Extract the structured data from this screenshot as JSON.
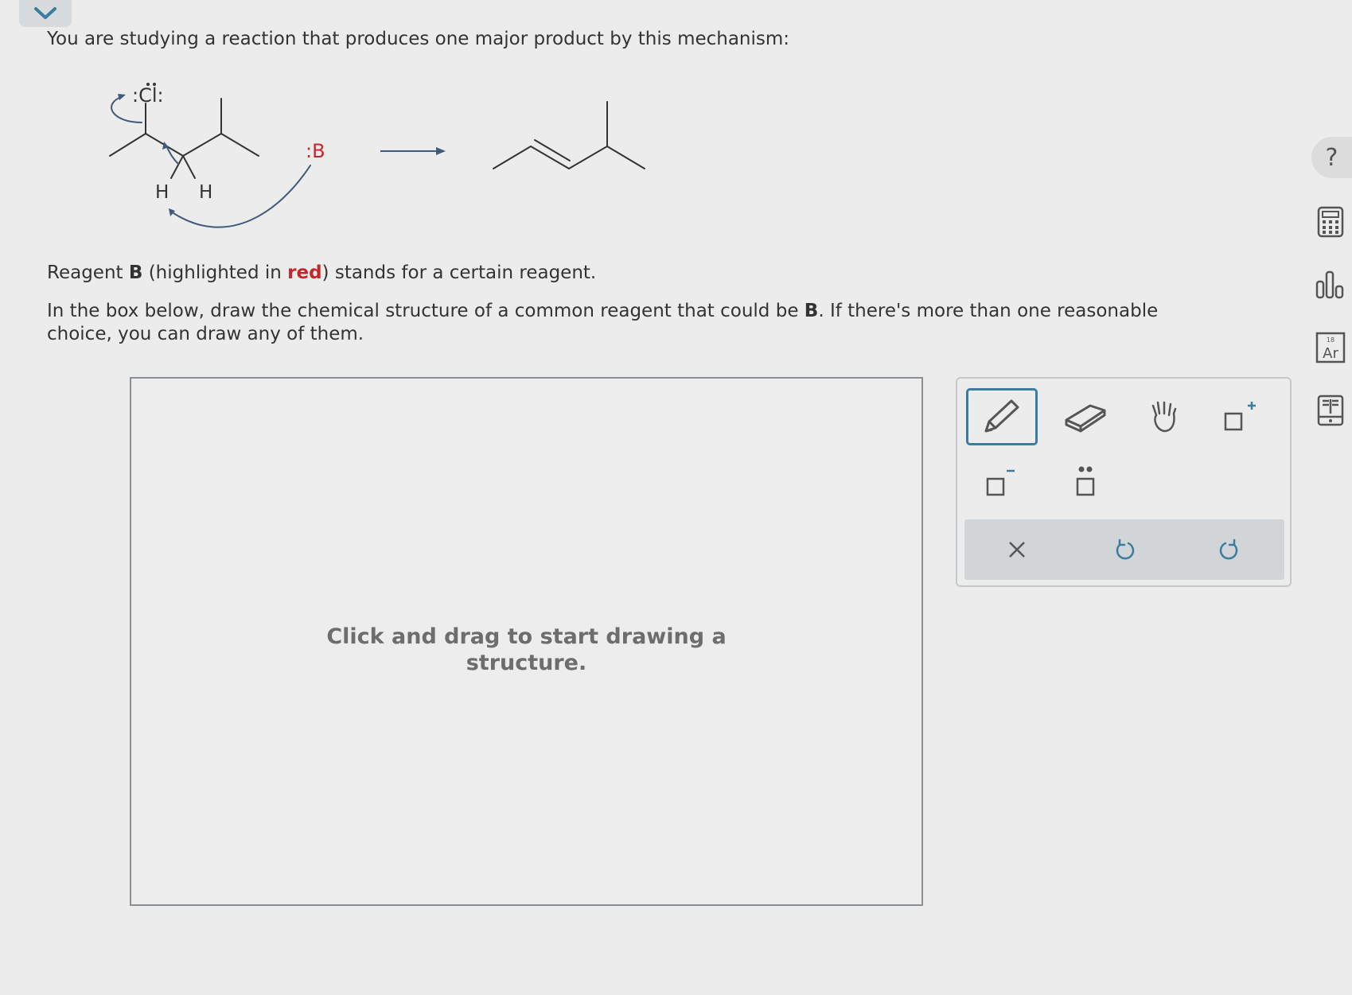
{
  "prompt": "You are studying a reaction that produces one major product by this mechanism:",
  "mechanism": {
    "leaving_group": ":Cl:",
    "hydrogen_left": "H",
    "hydrogen_right": "H",
    "base": ":B"
  },
  "reagent_line": {
    "part1": "Reagent ",
    "b": "B",
    "part2": " (highlighted in ",
    "red_word": "red",
    "part3": ") stands for a certain reagent."
  },
  "instruction": {
    "part1": "In the box below, draw the chemical structure of a common reagent that could be ",
    "b": "B",
    "part2": ". If there's more than one reasonable choice, you can draw any of them."
  },
  "drawing_area": {
    "hint": "Click and drag to start drawing a structure."
  },
  "toolbar": {
    "tools": [
      "pencil-icon",
      "eraser-icon",
      "hand-icon",
      "add-positive-charge-icon",
      "add-negative-charge-icon",
      "add-lone-pair-icon"
    ],
    "actions": [
      "clear-icon",
      "undo-icon",
      "redo-icon"
    ]
  },
  "side_tools": {
    "help": "?",
    "periodic_symbol": "Ar",
    "periodic_number": "18"
  },
  "colors": {
    "accent": "#3b7d9e",
    "highlight_red": "#c3282d",
    "arrow_blue": "#3f5a7a"
  }
}
